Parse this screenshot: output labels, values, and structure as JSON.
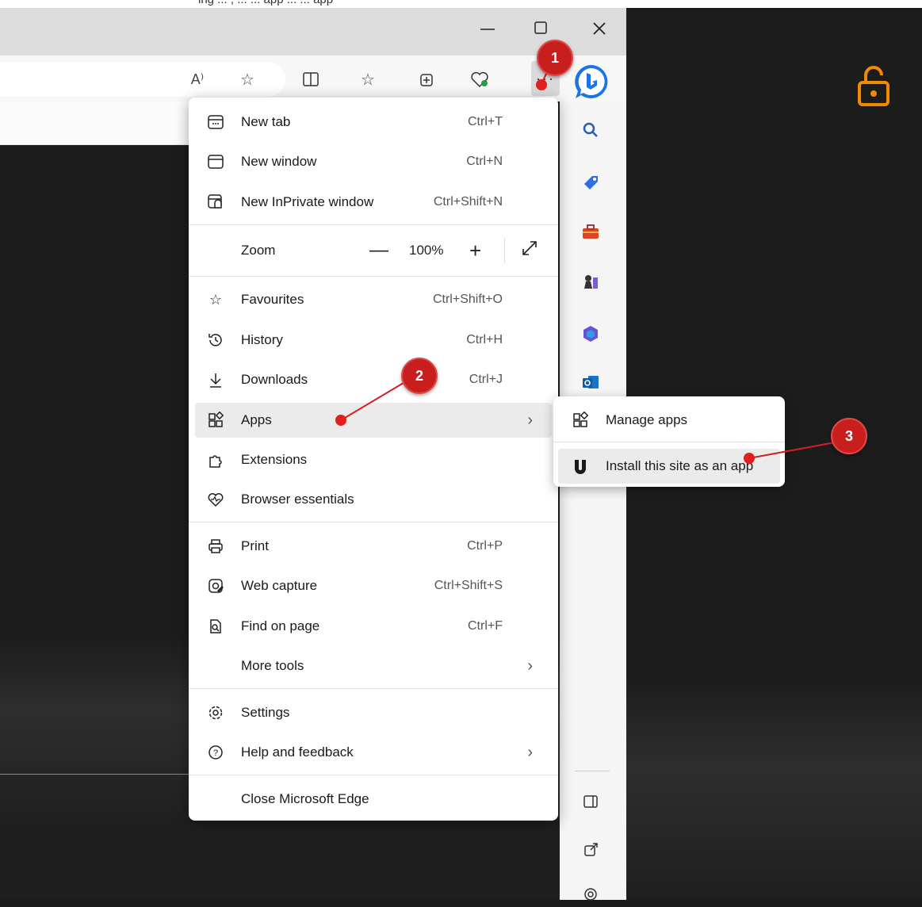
{
  "caption_cut": "ing ... , ... ... app ... ... app",
  "window_controls": {
    "minimize": "—",
    "maximize": "☐",
    "close": "✕"
  },
  "toolbar": {
    "read_aloud": "A⁾",
    "more": "···"
  },
  "menu": {
    "new_tab": {
      "label": "New tab",
      "shortcut": "Ctrl+T"
    },
    "new_window": {
      "label": "New window",
      "shortcut": "Ctrl+N"
    },
    "new_inprivate": {
      "label": "New InPrivate window",
      "shortcut": "Ctrl+Shift+N"
    },
    "zoom": {
      "label": "Zoom",
      "value": "100%",
      "minus": "—",
      "plus": "+"
    },
    "favourites": {
      "label": "Favourites",
      "shortcut": "Ctrl+Shift+O"
    },
    "history": {
      "label": "History",
      "shortcut": "Ctrl+H"
    },
    "downloads": {
      "label": "Downloads",
      "shortcut": "Ctrl+J"
    },
    "apps": {
      "label": "Apps"
    },
    "extensions": {
      "label": "Extensions"
    },
    "browser_essentials": {
      "label": "Browser essentials"
    },
    "print": {
      "label": "Print",
      "shortcut": "Ctrl+P"
    },
    "web_capture": {
      "label": "Web capture",
      "shortcut": "Ctrl+Shift+S"
    },
    "find_on_page": {
      "label": "Find on page",
      "shortcut": "Ctrl+F"
    },
    "more_tools": {
      "label": "More tools"
    },
    "settings": {
      "label": "Settings"
    },
    "help_feedback": {
      "label": "Help and feedback"
    },
    "close_edge": {
      "label": "Close Microsoft Edge"
    }
  },
  "submenu": {
    "manage_apps": {
      "label": "Manage apps"
    },
    "install_site": {
      "label": "Install this site as an app"
    }
  },
  "steps": [
    "1",
    "2",
    "3"
  ],
  "colors": {
    "badge": "#c81e1e",
    "lock": "#f08a00",
    "menu_hover": "#ebebeb"
  }
}
